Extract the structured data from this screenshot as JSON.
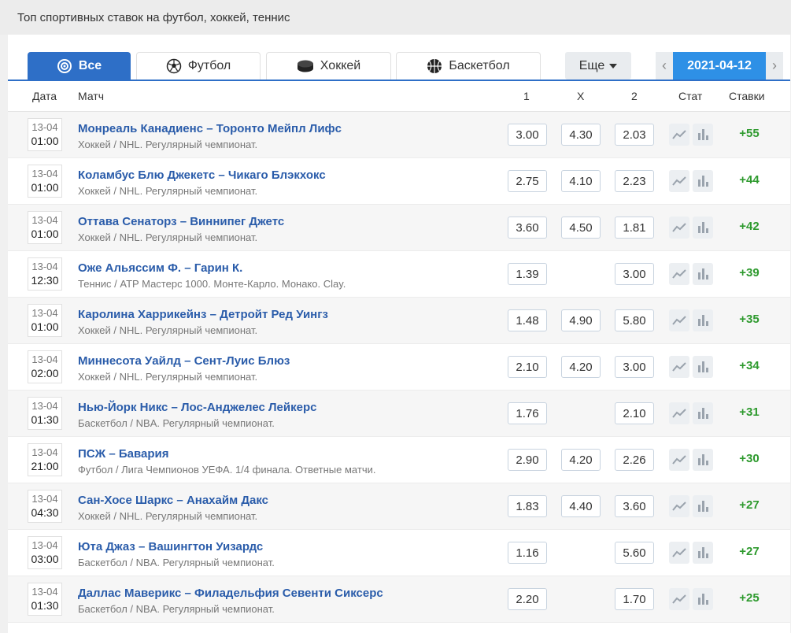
{
  "header": {
    "title": "Топ спортивных ставок на футбол, хоккей, теннис"
  },
  "tabs": [
    {
      "label": "Все",
      "icon": "all-sports-icon",
      "active": true
    },
    {
      "label": "Футбол",
      "icon": "football-icon",
      "active": false
    },
    {
      "label": "Хоккей",
      "icon": "hockey-puck-icon",
      "active": false
    },
    {
      "label": "Баскетбол",
      "icon": "basketball-icon",
      "active": false
    }
  ],
  "more": {
    "label": "Еще"
  },
  "date_nav": {
    "prev": "‹",
    "value": "2021-04-12",
    "next": "›"
  },
  "columns": {
    "date": "Дата",
    "match": "Матч",
    "c1": "1",
    "cx": "X",
    "c2": "2",
    "stat": "Стат",
    "bets": "Ставки"
  },
  "colors": {
    "accent": "#2e6fc7",
    "date_active": "#2e90e6",
    "link": "#2a5caa",
    "positive": "#2e9a2e"
  },
  "rows": [
    {
      "date": "13-04",
      "time": "01:00",
      "name": "Монреаль Канадиенс – Торонто Мейпл Лифс",
      "league": "Хоккей / NHL. Регулярный чемпионат.",
      "o1": "3.00",
      "ox": "4.30",
      "o2": "2.03",
      "bets": "+55"
    },
    {
      "date": "13-04",
      "time": "01:00",
      "name": "Коламбус Блю Джекетс – Чикаго Блэкхокс",
      "league": "Хоккей / NHL. Регулярный чемпионат.",
      "o1": "2.75",
      "ox": "4.10",
      "o2": "2.23",
      "bets": "+44"
    },
    {
      "date": "13-04",
      "time": "01:00",
      "name": "Оттава Сенаторз – Виннипег Джетс",
      "league": "Хоккей / NHL. Регулярный чемпионат.",
      "o1": "3.60",
      "ox": "4.50",
      "o2": "1.81",
      "bets": "+42"
    },
    {
      "date": "13-04",
      "time": "12:30",
      "name": "Оже Альяссим Ф. – Гарин К.",
      "league": "Теннис / ATP Мастерс 1000. Монте-Карло. Монако. Clay.",
      "o1": "1.39",
      "ox": "",
      "o2": "3.00",
      "bets": "+39"
    },
    {
      "date": "13-04",
      "time": "01:00",
      "name": "Каролина Харрикейнз – Детройт Ред Уингз",
      "league": "Хоккей / NHL. Регулярный чемпионат.",
      "o1": "1.48",
      "ox": "4.90",
      "o2": "5.80",
      "bets": "+35"
    },
    {
      "date": "13-04",
      "time": "02:00",
      "name": "Миннесота Уайлд – Сент-Луис Блюз",
      "league": "Хоккей / NHL. Регулярный чемпионат.",
      "o1": "2.10",
      "ox": "4.20",
      "o2": "3.00",
      "bets": "+34"
    },
    {
      "date": "13-04",
      "time": "01:30",
      "name": "Нью-Йорк Никс – Лос-Анджелес Лейкерс",
      "league": "Баскетбол / NBA. Регулярный чемпионат.",
      "o1": "1.76",
      "ox": "",
      "o2": "2.10",
      "bets": "+31"
    },
    {
      "date": "13-04",
      "time": "21:00",
      "name": "ПСЖ – Бавария",
      "league": "Футбол / Лига Чемпионов УЕФА. 1/4 финала. Ответные матчи.",
      "o1": "2.90",
      "ox": "4.20",
      "o2": "2.26",
      "bets": "+30"
    },
    {
      "date": "13-04",
      "time": "04:30",
      "name": "Сан-Хосе Шаркс – Анахайм Дакс",
      "league": "Хоккей / NHL. Регулярный чемпионат.",
      "o1": "1.83",
      "ox": "4.40",
      "o2": "3.60",
      "bets": "+27"
    },
    {
      "date": "13-04",
      "time": "03:00",
      "name": "Юта Джаз – Вашингтон Уизардс",
      "league": "Баскетбол / NBA. Регулярный чемпионат.",
      "o1": "1.16",
      "ox": "",
      "o2": "5.60",
      "bets": "+27"
    },
    {
      "date": "13-04",
      "time": "01:30",
      "name": "Даллас Маверикс – Филадельфия Севенти Сиксерс",
      "league": "Баскетбол / NBA. Регулярный чемпионат.",
      "o1": "2.20",
      "ox": "",
      "o2": "1.70",
      "bets": "+25"
    }
  ]
}
